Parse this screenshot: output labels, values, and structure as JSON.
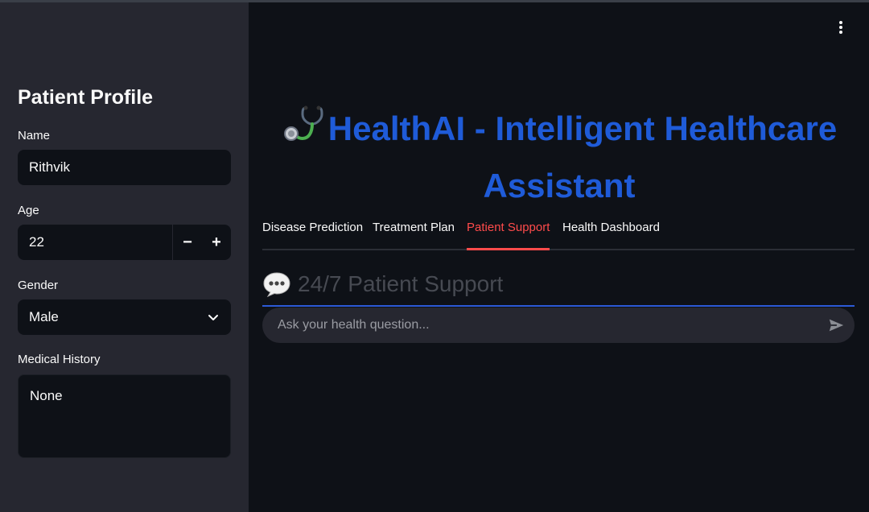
{
  "sidebar": {
    "title": "Patient Profile",
    "name_label": "Name",
    "name_value": "Rithvik",
    "age_label": "Age",
    "age_value": "22",
    "age_minus": "−",
    "age_plus": "+",
    "gender_label": "Gender",
    "gender_value": "Male",
    "history_label": "Medical History",
    "history_value": "None"
  },
  "main": {
    "title": "HealthAI - Intelligent Healthcare Assistant",
    "tabs": [
      {
        "label": "Disease Prediction"
      },
      {
        "label": "Treatment Plan"
      },
      {
        "label": "Patient Support"
      },
      {
        "label": "Health Dashboard"
      }
    ],
    "active_tab": "Patient Support",
    "support_header": "24/7 Patient Support",
    "chat_placeholder": "Ask your health question..."
  },
  "icons": {
    "title_icon": "stethoscope-icon",
    "support_icon": "speech-bubble-icon",
    "menu_icon": "kebab-menu-icon",
    "send_icon": "send-icon",
    "gender_dropdown": "chevron-down-icon"
  },
  "colors": {
    "background": "#0e1117",
    "sidebar": "#262730",
    "title": "#1f5bd8",
    "accent": "#ff4b4b"
  }
}
